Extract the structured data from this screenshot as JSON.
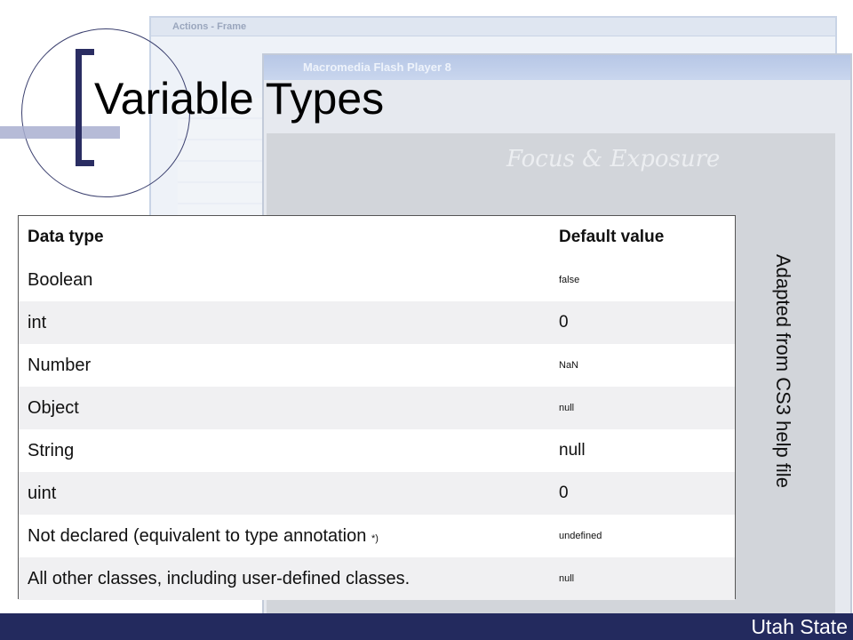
{
  "slide": {
    "title": "Variable Types",
    "side_note": "Adapted from CS3 help file",
    "footer": "Utah State"
  },
  "background": {
    "actions_window_title": "Actions - Frame",
    "player_window_title": "Macromedia Flash Player 8",
    "focus_heading": "Focus & Exposure"
  },
  "table": {
    "headers": [
      "Data type",
      "Default value"
    ],
    "rows": [
      {
        "type": "Boolean",
        "default": "false",
        "default_size": "small"
      },
      {
        "type": "int",
        "default": "0",
        "default_size": "large"
      },
      {
        "type": "Number",
        "default": "NaN",
        "default_size": "small"
      },
      {
        "type": "Object",
        "default": "null",
        "default_size": "small"
      },
      {
        "type": "String",
        "default": "null",
        "default_size": "large"
      },
      {
        "type": "uint",
        "default": "0",
        "default_size": "large"
      },
      {
        "type": "Not declared (equivalent to type annotation ",
        "type_suffix": "*)",
        "default": "undefined",
        "default_size": "small"
      },
      {
        "type": "All other classes, including user-defined classes.",
        "default": "null",
        "default_size": "small"
      }
    ]
  },
  "colors": {
    "accent": "#2a2d62",
    "footer_bar": "#232a5e",
    "stripe": "#f0f0f2"
  }
}
